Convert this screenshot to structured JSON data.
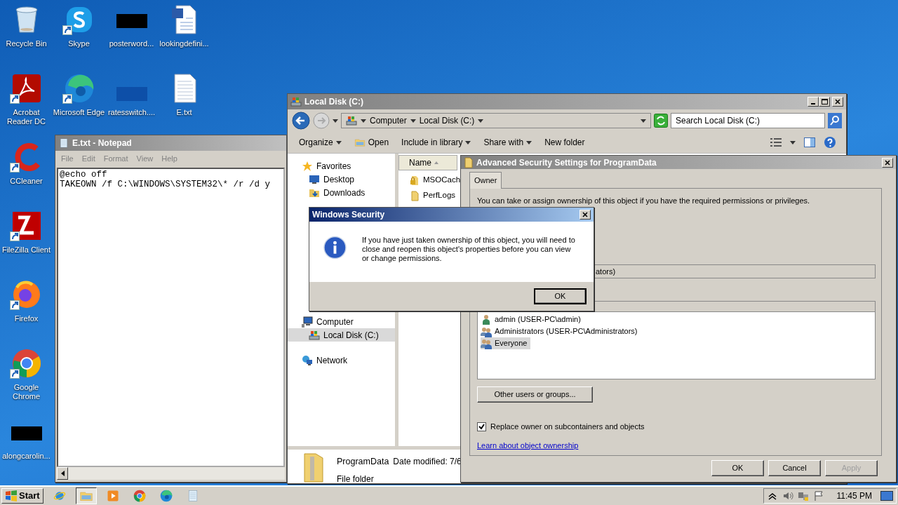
{
  "desktop_icons": [
    {
      "label": "Recycle Bin",
      "kind": "recycle",
      "shortcut": false
    },
    {
      "label": "Skype",
      "kind": "skype",
      "shortcut": true
    },
    {
      "label": "posterword...",
      "kind": "redacted",
      "shortcut": false
    },
    {
      "label": "lookingdefini...",
      "kind": "word",
      "shortcut": false
    },
    {
      "label": "Acrobat Reader DC",
      "kind": "acrobat",
      "shortcut": true
    },
    {
      "label": "Microsoft Edge",
      "kind": "edge",
      "shortcut": true
    },
    {
      "label": "ratesswitch....",
      "kind": "bluebox",
      "shortcut": false
    },
    {
      "label": "E.txt",
      "kind": "text",
      "shortcut": false
    },
    {
      "label": "CCleaner",
      "kind": "ccleaner",
      "shortcut": true
    },
    {
      "label": "FileZilla Client",
      "kind": "filezilla",
      "shortcut": true
    },
    {
      "label": "Firefox",
      "kind": "firefox",
      "shortcut": true
    },
    {
      "label": "Google Chrome",
      "kind": "chrome",
      "shortcut": true
    },
    {
      "label": "alongcarolin...",
      "kind": "redacted",
      "shortcut": false
    }
  ],
  "notepad": {
    "title": "E.txt - Notepad",
    "menu": [
      "File",
      "Edit",
      "Format",
      "View",
      "Help"
    ],
    "lines": [
      "@echo off",
      "TAKEOWN /f C:\\WINDOWS\\SYSTEM32\\* /r /d y"
    ]
  },
  "explorer": {
    "title": "Local Disk (C:)",
    "breadcrumb": [
      "Computer",
      "Local Disk (C:)"
    ],
    "search": {
      "placeholder": "Search Local Disk (C:)"
    },
    "toolbar": [
      {
        "label": "Organize",
        "kind": "menu"
      },
      {
        "label": "Open",
        "kind": "open"
      },
      {
        "label": "Include in library",
        "kind": "menu"
      },
      {
        "label": "Share with",
        "kind": "menu"
      },
      {
        "label": "New folder",
        "kind": "button"
      }
    ],
    "nav": [
      {
        "label": "Favorites",
        "kind": "star",
        "selected": false,
        "children": [
          {
            "label": "Desktop",
            "kind": "desktop",
            "selected": false
          },
          {
            "label": "Downloads",
            "kind": "downloads",
            "selected": false
          }
        ]
      },
      {
        "label": "Computer",
        "kind": "computer",
        "selected": false,
        "children": [
          {
            "label": "Local Disk (C:)",
            "kind": "drive",
            "selected": true
          }
        ]
      },
      {
        "label": "Network",
        "kind": "network",
        "selected": false
      }
    ],
    "column_header": "Name",
    "files": [
      {
        "label": "MSOCach",
        "kind": "locked"
      },
      {
        "label": "PerfLogs",
        "kind": "folder"
      }
    ],
    "details": {
      "name": "ProgramData",
      "date": "Date modified: 7/6",
      "type": "File folder"
    }
  },
  "advanced_security": {
    "title": "Advanced Security Settings for ProgramData",
    "tabs": [
      {
        "label": "Owner",
        "selected": true
      }
    ],
    "intro": "You can take or assign ownership of this object if you have the required permissions or privileges.",
    "owner_field": {
      "value": "ators)"
    },
    "owners": [
      {
        "label": "admin (USER-PC\\admin)",
        "kind": "user",
        "selected": false
      },
      {
        "label": "Administrators (USER-PC\\Administrators)",
        "kind": "group",
        "selected": false
      },
      {
        "label": "Everyone",
        "kind": "group",
        "selected": true
      }
    ],
    "other_button": "Other users or groups...",
    "replace_checkbox": {
      "label": "Replace owner on subcontainers and objects",
      "checked": true
    },
    "link": "Learn about object ownership",
    "buttons": [
      {
        "label": "OK",
        "disabled": false
      },
      {
        "label": "Cancel",
        "disabled": false
      },
      {
        "label": "Apply",
        "disabled": true
      }
    ]
  },
  "security_dialog": {
    "title": "Windows Security",
    "message": "If you have just taken ownership of this object, you will need to close and reopen this object's properties before you can view or change permissions.",
    "button": "OK"
  },
  "taskbar": {
    "start": "Start",
    "apps": [
      {
        "kind": "ie",
        "active": false
      },
      {
        "kind": "explorer",
        "active": true
      },
      {
        "kind": "media",
        "active": false
      },
      {
        "kind": "chrome",
        "active": false
      },
      {
        "kind": "edge",
        "active": false
      },
      {
        "kind": "notepad",
        "active": false
      }
    ],
    "tray": [
      {
        "kind": "chevron"
      },
      {
        "kind": "volume"
      },
      {
        "kind": "network"
      },
      {
        "kind": "flag"
      }
    ],
    "clock": "11:45 PM"
  }
}
